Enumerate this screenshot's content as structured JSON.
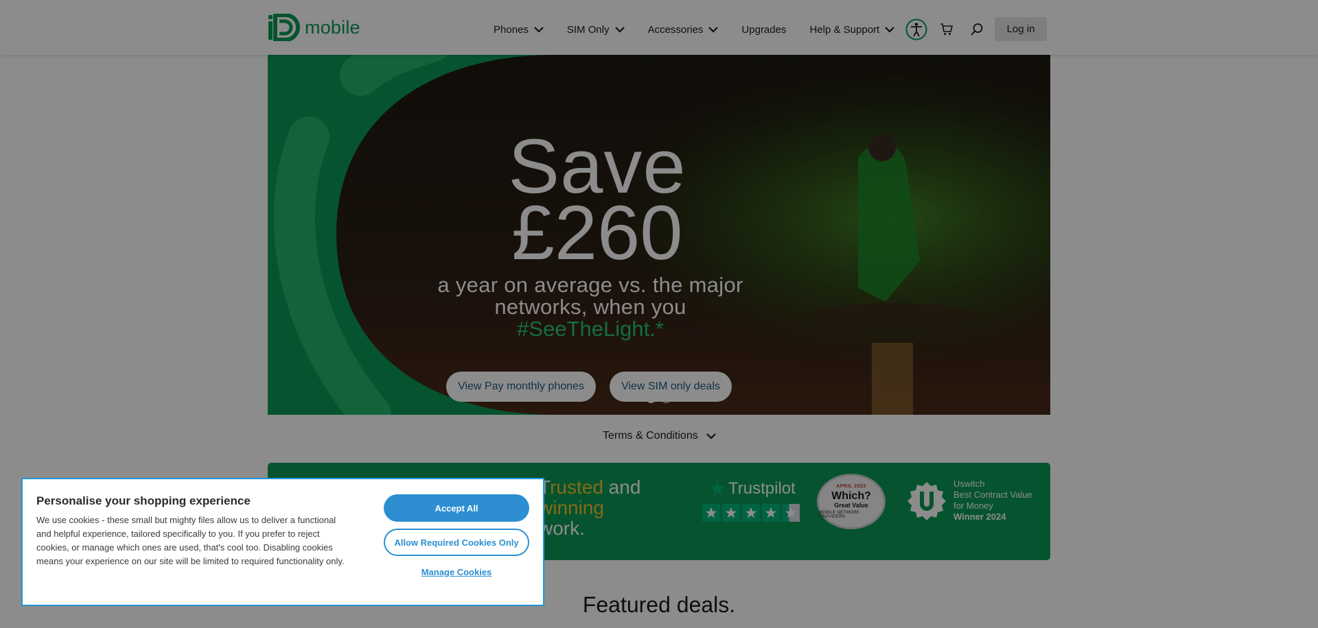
{
  "header": {
    "logo_text": "mobile",
    "nav": [
      {
        "label": "Phones",
        "has_dropdown": true
      },
      {
        "label": "SIM Only",
        "has_dropdown": true
      },
      {
        "label": "Accessories",
        "has_dropdown": true
      },
      {
        "label": "Upgrades",
        "has_dropdown": false
      },
      {
        "label": "Help & Support",
        "has_dropdown": true
      }
    ],
    "icons": [
      "accessibility-icon",
      "cart-icon",
      "search-icon"
    ],
    "login_label": "Log in"
  },
  "hero": {
    "save_word": "Save",
    "save_amount": "£260",
    "subtitle": "a year on average vs. the major networks, when you",
    "hashtag": "#SeeTheLight.*",
    "buttons": [
      {
        "label": "View Pay monthly phones"
      },
      {
        "label": "View SIM only deals"
      }
    ],
    "carousel": {
      "slides": 2,
      "active": 1
    }
  },
  "terms_label": "Terms & Conditions",
  "trust": {
    "headline_start": "T",
    "headline_hl1": "rusted",
    "headline_mid": " and ",
    "headline_hl2": "winning",
    "headline_end": "work.",
    "trustpilot_name": "Trustpilot",
    "trustpilot_stars": 4.5,
    "which": {
      "date": "APRIL 2023",
      "logo": "Which?",
      "sub": "Great Value",
      "foot": "MOBILE NETWORK PROVIDERS"
    },
    "uswitch": {
      "line1": "Uswitch",
      "line2": "Best Contract Value",
      "line3": "for Money",
      "line4": "Winner 2024"
    }
  },
  "featured_title": "Featured deals.",
  "cookie": {
    "title": "Personalise your shopping experience",
    "text": "We use cookies - these small but mighty files allow us to deliver a functional and helpful experience, tailored specifically to you. If you prefer to reject cookies, or manage which ones are used, that's cool too. Disabling cookies means your experience on our site will be limited to required functionality only.",
    "accept_label": "Accept All",
    "required_label": "Allow Required Cookies Only",
    "manage_label": "Manage Cookies"
  },
  "colors": {
    "brand_green": "#0b9a57",
    "accent_blue": "#2d8fd1",
    "hashtag_green": "#23c878",
    "highlight_gold": "#f2c230"
  }
}
